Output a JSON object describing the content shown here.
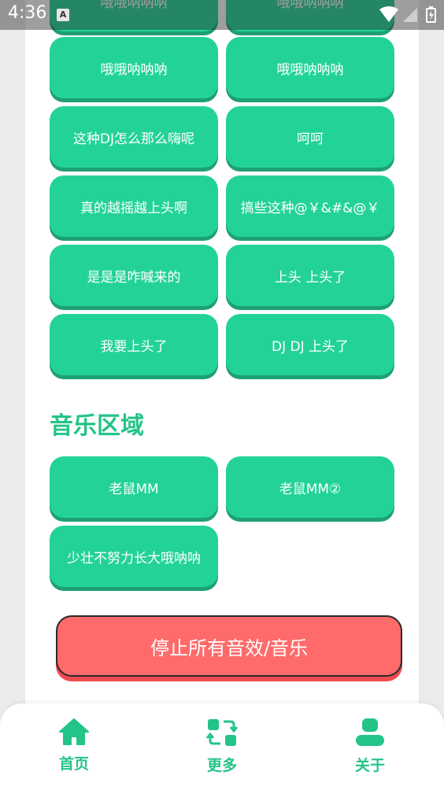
{
  "status_bar": {
    "time": "4:36",
    "notification_icon": "A"
  },
  "sound_buttons_top": [
    {
      "label": "哦哦呐呐呐"
    },
    {
      "label": "哦哦呐呐呐"
    }
  ],
  "sound_buttons": [
    {
      "label": "哦哦呐呐呐"
    },
    {
      "label": "哦哦呐呐呐"
    },
    {
      "label": "这种DJ怎么那么嗨呢"
    },
    {
      "label": "呵呵"
    },
    {
      "label": "真的越摇越上头啊"
    },
    {
      "label": "搞些这种@￥&#&@￥"
    },
    {
      "label": "是是是咋喊来的"
    },
    {
      "label": "上头 上头了"
    },
    {
      "label": "我要上头了"
    },
    {
      "label": "DJ DJ 上头了"
    }
  ],
  "music_section": {
    "title": "音乐区域",
    "buttons": [
      {
        "label": "老鼠MM"
      },
      {
        "label": "老鼠MM②"
      },
      {
        "label": "少壮不努力长大哦呐呐"
      }
    ]
  },
  "stop_button": {
    "label": "停止所有音效/音乐"
  },
  "bottom_nav": {
    "items": [
      {
        "label": "首页",
        "icon": "home-icon"
      },
      {
        "label": "更多",
        "icon": "apps-swap-icon"
      },
      {
        "label": "关于",
        "icon": "user-icon"
      }
    ]
  },
  "colors": {
    "accent": "#23d396",
    "accent_shadow": "#1ea072",
    "title_green": "#23c488",
    "stop_red": "#ff6b6b"
  }
}
